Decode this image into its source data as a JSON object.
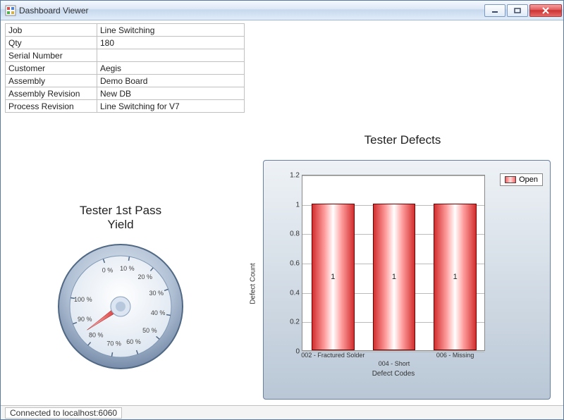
{
  "window": {
    "title": "Dashboard Viewer"
  },
  "info": {
    "rows": [
      {
        "label": "Job",
        "value": "Line Switching"
      },
      {
        "label": "Qty",
        "value": "180"
      },
      {
        "label": "Serial Number",
        "value": ""
      },
      {
        "label": "Customer",
        "value": "Aegis"
      },
      {
        "label": "Assembly",
        "value": "Demo Board"
      },
      {
        "label": "Assembly Revision",
        "value": "New DB"
      },
      {
        "label": "Process Revision",
        "value": "Line Switching for V7"
      }
    ]
  },
  "gauge": {
    "title_line1": "Tester 1st Pass",
    "title_line2": "Yield",
    "ticks": [
      "0 %",
      "10 %",
      "20 %",
      "30 %",
      "40 %",
      "50 %",
      "60 %",
      "70 %",
      "80 %",
      "90 %",
      "100 %"
    ],
    "value_pct": 85
  },
  "chart_title": "Tester Defects",
  "legend": {
    "label": "Open"
  },
  "chart_data": {
    "type": "bar",
    "title": "Tester Defects",
    "xlabel": "Defect Codes",
    "ylabel": "Defect Count",
    "ylim": [
      0,
      1.2
    ],
    "yticks": [
      0,
      0.2,
      0.4,
      0.6,
      0.8,
      1,
      1.2
    ],
    "categories": [
      "002 - Fractured Solder",
      "004 - Short",
      "006 - Missing"
    ],
    "series": [
      {
        "name": "Open",
        "values": [
          1,
          1,
          1
        ]
      }
    ]
  },
  "status": {
    "connection": "Connected to localhost:6060"
  }
}
